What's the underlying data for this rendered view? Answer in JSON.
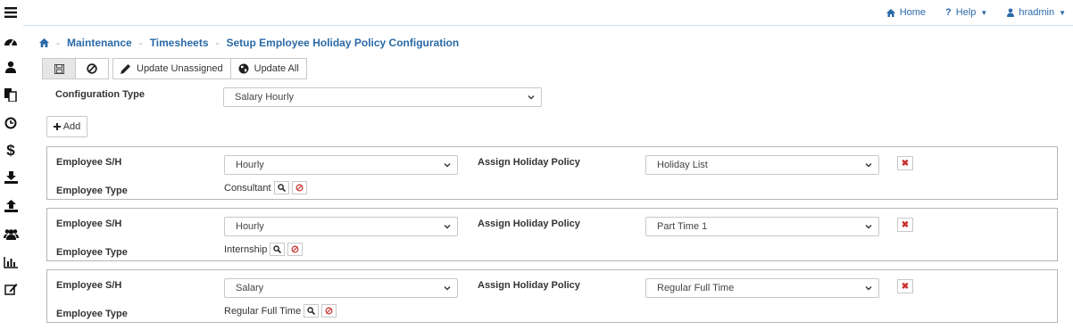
{
  "sidebar": {
    "icons": [
      "menu-icon",
      "dashboard-icon",
      "user-icon",
      "documents-icon",
      "clock-icon",
      "dollar-icon",
      "download-icon",
      "upload-icon",
      "users-icon",
      "bar-chart-icon",
      "edit-icon"
    ]
  },
  "topnav": {
    "home": "Home",
    "help": "Help",
    "user": "hradmin"
  },
  "breadcrumb": {
    "items": [
      "Maintenance",
      "Timesheets",
      "Setup Employee Holiday Policy Configuration"
    ]
  },
  "toolbar": {
    "update_unassigned": "Update Unassigned",
    "update_all": "Update All"
  },
  "config": {
    "label": "Configuration Type",
    "value": "Salary Hourly"
  },
  "add_label": "Add",
  "labels": {
    "employee_sh": "Employee S/H",
    "employee_type": "Employee Type",
    "assign_policy": "Assign Holiday Policy"
  },
  "rows": [
    {
      "employee_sh": "Hourly",
      "policy": "Holiday List",
      "employee_type": "Consultant"
    },
    {
      "employee_sh": "Hourly",
      "policy": "Part Time 1",
      "employee_type": "Internship"
    },
    {
      "employee_sh": "Salary",
      "policy": "Regular Full Time",
      "employee_type": "Regular Full Time"
    }
  ],
  "colors": {
    "link": "#2a6aa8",
    "danger": "#c9302c"
  }
}
